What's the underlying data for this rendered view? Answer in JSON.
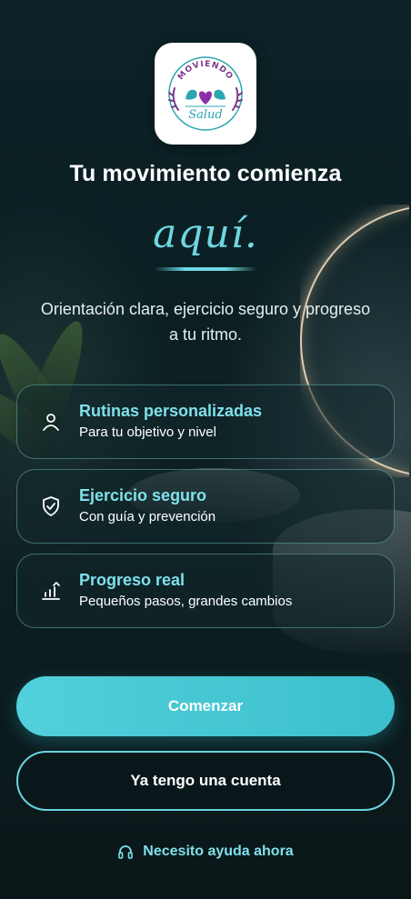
{
  "brand": {
    "logo_top": "MOVIENDO",
    "logo_bottom": "Salud"
  },
  "hero": {
    "title": "Tu movimiento comienza",
    "script_word": "aquí.",
    "subtitle": "Orientación clara, ejercicio seguro y progreso a tu ritmo."
  },
  "features": [
    {
      "icon": "user-icon",
      "title": "Rutinas personalizadas",
      "subtitle": "Para tu objetivo y nivel"
    },
    {
      "icon": "shield-check-icon",
      "title": "Ejercicio seguro",
      "subtitle": "Con guía y prevención"
    },
    {
      "icon": "chart-trend-icon",
      "title": "Progreso real",
      "subtitle": "Pequeños pasos, grandes cambios"
    }
  ],
  "actions": {
    "primary_label": "Comenzar",
    "secondary_label": "Ya tengo una cuenta",
    "help_label": "Necesito ayuda ahora",
    "help_icon": "headphones-icon"
  },
  "colors": {
    "accent": "#52d0dc",
    "accent_text": "#7fe0ea",
    "logo_purple": "#7a3a8c",
    "logo_teal": "#2aa7b3",
    "heart": "#8e2fa6"
  }
}
